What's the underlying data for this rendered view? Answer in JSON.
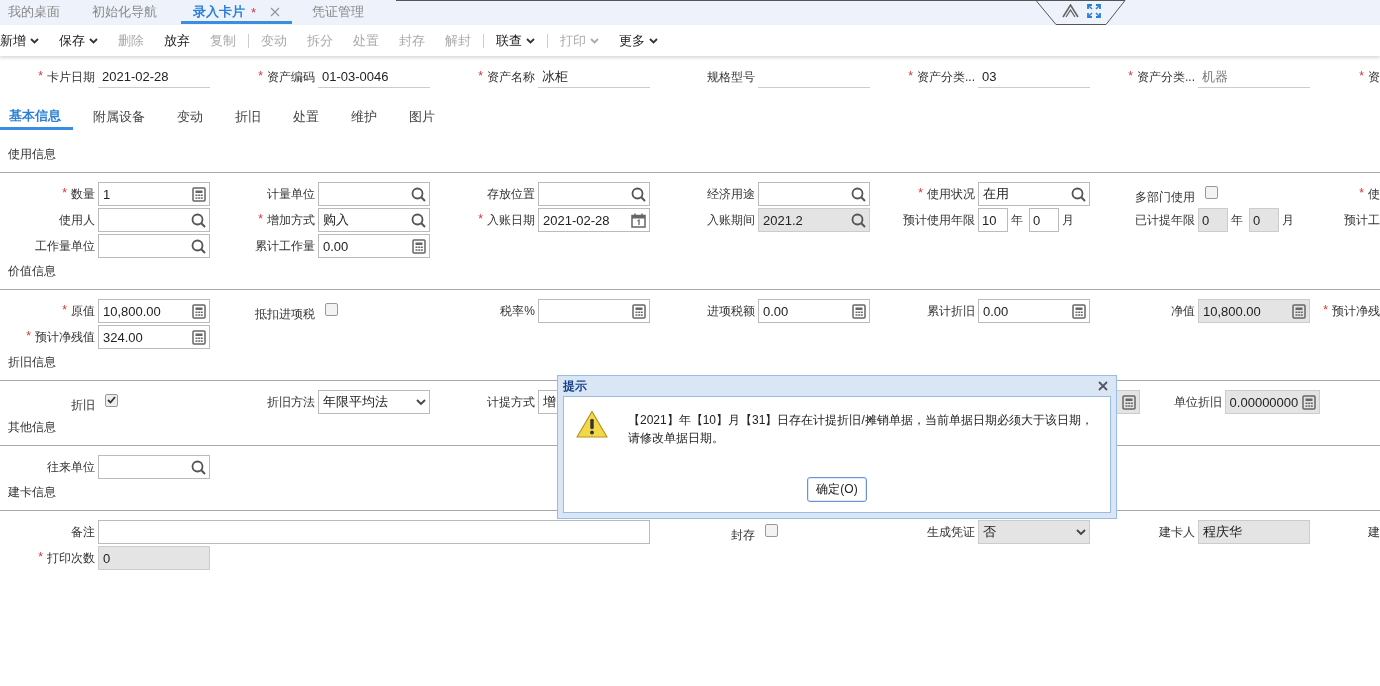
{
  "tabs": [
    {
      "label": "我的桌面",
      "selected": false
    },
    {
      "label": "初始化导航",
      "selected": false
    },
    {
      "label": "录入卡片",
      "marker": "*",
      "closable": true,
      "selected": true
    },
    {
      "label": "凭证管理",
      "selected": false
    }
  ],
  "toolbar": [
    {
      "kind": "button",
      "label": "新增",
      "dropdown": true,
      "disabled": false
    },
    {
      "kind": "button",
      "label": "保存",
      "dropdown": true,
      "disabled": false
    },
    {
      "kind": "button",
      "label": "删除",
      "dropdown": false,
      "disabled": true
    },
    {
      "kind": "button",
      "label": "放弃",
      "dropdown": false,
      "disabled": false
    },
    {
      "kind": "button",
      "label": "复制",
      "dropdown": false,
      "disabled": true
    },
    {
      "kind": "separator"
    },
    {
      "kind": "button",
      "label": "变动",
      "dropdown": false,
      "disabled": true
    },
    {
      "kind": "button",
      "label": "拆分",
      "dropdown": false,
      "disabled": true
    },
    {
      "kind": "button",
      "label": "处置",
      "dropdown": false,
      "disabled": true
    },
    {
      "kind": "button",
      "label": "封存",
      "dropdown": false,
      "disabled": true
    },
    {
      "kind": "button",
      "label": "解封",
      "dropdown": false,
      "disabled": true
    },
    {
      "kind": "separator"
    },
    {
      "kind": "button",
      "label": "联查",
      "dropdown": true,
      "disabled": false
    },
    {
      "kind": "separator"
    },
    {
      "kind": "button",
      "label": "打印",
      "dropdown": true,
      "disabled": true
    },
    {
      "kind": "button",
      "label": "更多",
      "dropdown": true,
      "disabled": false
    }
  ],
  "header_fields": [
    {
      "kind": "underline",
      "required_mark": "*",
      "label": "卡片日期",
      "value": "2021-02-28",
      "disabled": false
    },
    {
      "kind": "underline",
      "required_mark": "*",
      "label": "资产编码",
      "value": "01-03-0046",
      "disabled": false
    },
    {
      "kind": "underline",
      "required_mark": "*",
      "label": "资产名称",
      "value": "冰柜",
      "disabled": false
    },
    {
      "kind": "underline",
      "label": "规格型号"
    },
    {
      "kind": "underline",
      "required_mark": "*",
      "label": "资产分类...",
      "value": "03",
      "disabled": false
    },
    {
      "kind": "underline",
      "required_mark": "*",
      "label": "资产分类...",
      "value": "机器",
      "disabled": true
    },
    {
      "kind": "cut",
      "required_mark": "*",
      "label": "资"
    }
  ],
  "subtabs": [
    {
      "label": "基本信息",
      "selected": true
    },
    {
      "label": "附属设备",
      "selected": false
    },
    {
      "label": "变动",
      "selected": false
    },
    {
      "label": "折旧",
      "selected": false
    },
    {
      "label": "处置",
      "selected": false
    },
    {
      "label": "维护",
      "selected": false
    },
    {
      "label": "图片",
      "selected": false
    }
  ],
  "sections": [
    {
      "title": "使用信息",
      "rows": [
        [
          {
            "kind": "calc",
            "required_mark": "*",
            "label": "数量",
            "value": "1",
            "disabled": false
          },
          {
            "kind": "search",
            "label": "计量单位",
            "disabled": false
          },
          {
            "kind": "search",
            "label": "存放位置",
            "disabled": false
          },
          {
            "kind": "search",
            "label": "经济用途",
            "disabled": false
          },
          {
            "kind": "search",
            "required_mark": "*",
            "label": "使用状况",
            "value": "在用",
            "disabled": false
          },
          {
            "kind": "checkbox",
            "label": "多部门使用",
            "checked": false
          },
          {
            "kind": "cut",
            "required_mark": "*",
            "label": "使"
          }
        ],
        [
          {
            "kind": "search",
            "label": "使用人",
            "disabled": false
          },
          {
            "kind": "search",
            "required_mark": "*",
            "label": "增加方式",
            "value": "购入",
            "disabled": false
          },
          {
            "kind": "date",
            "required_mark": "*",
            "label": "入账日期",
            "value": "2021-02-28",
            "disabled": false
          },
          {
            "kind": "search",
            "label": "入账期间",
            "value": "2021.2",
            "disabled": true
          },
          {
            "kind": "pair",
            "label": "预计使用年限",
            "disabled": false,
            "parts": [
              {
                "value": "10",
                "unit": "年"
              },
              {
                "value": "0",
                "unit": "月"
              }
            ]
          },
          {
            "kind": "pair",
            "label": "已计提年限",
            "disabled": true,
            "parts": [
              {
                "value": "0",
                "unit": "年"
              },
              {
                "value": "0",
                "unit": "月"
              }
            ]
          },
          {
            "kind": "cut",
            "label": "预计工"
          }
        ],
        [
          {
            "kind": "search",
            "label": "工作量单位",
            "disabled": false
          },
          {
            "kind": "calc",
            "label": "累计工作量",
            "value": "0.00",
            "disabled": false
          }
        ]
      ]
    },
    {
      "title": "价值信息",
      "rows": [
        [
          {
            "kind": "calc",
            "required_mark": "*",
            "label": "原值",
            "value": "10,800.00",
            "disabled": false
          },
          {
            "kind": "checkbox",
            "label": "抵扣进项税",
            "checked": false
          },
          {
            "kind": "calc",
            "label": "税率%",
            "disabled": false
          },
          {
            "kind": "calc",
            "label": "进项税额",
            "value": "0.00",
            "disabled": false
          },
          {
            "kind": "calc",
            "label": "累计折旧",
            "value": "0.00",
            "disabled": false
          },
          {
            "kind": "calc",
            "label": "净值",
            "value": "10,800.00",
            "disabled": true
          },
          {
            "kind": "cut",
            "required_mark": "*",
            "label": "预计净残"
          }
        ],
        [
          {
            "kind": "calc",
            "required_mark": "*",
            "label": "预计净残值",
            "value": "324.00",
            "disabled": false
          }
        ]
      ]
    },
    {
      "title": "折旧信息",
      "rows": [
        [
          {
            "kind": "checkbox",
            "label": "折旧",
            "checked": true
          },
          {
            "kind": "select",
            "label": "折旧方法",
            "value": "年限平均法",
            "disabled": false
          },
          {
            "kind": "text",
            "label": "计提方式",
            "value": "增",
            "disabled": false
          },
          {
            "kind": "calc",
            "disabled": true
          },
          {
            "kind": "calc",
            "label": "单位折旧",
            "value": "0.00000000",
            "disabled": true
          }
        ]
      ]
    },
    {
      "title": "其他信息",
      "rows": [
        [
          {
            "kind": "search",
            "label": "往来单位",
            "disabled": false
          }
        ]
      ]
    },
    {
      "title": "建卡信息",
      "rows": [
        [
          {
            "kind": "memo",
            "label": "备注",
            "disabled": false
          },
          {
            "kind": "checkbox",
            "label": "封存",
            "checked": false
          },
          {
            "kind": "select",
            "label": "生成凭证",
            "value": "否",
            "disabled": true
          },
          {
            "kind": "text",
            "label": "建卡人",
            "value": "程庆华",
            "disabled": true
          },
          {
            "kind": "cut",
            "label": "建"
          }
        ],
        [
          {
            "kind": "text",
            "required_mark": "*",
            "label": "打印次数",
            "value": "0",
            "disabled": true
          }
        ]
      ]
    }
  ],
  "dialog": {
    "title": "提示",
    "message": "【2021】年【10】月【31】日存在计提折旧/摊销单据，当前单据日期必须大于该日期，请修改单据日期。",
    "button": "确定(O)"
  }
}
